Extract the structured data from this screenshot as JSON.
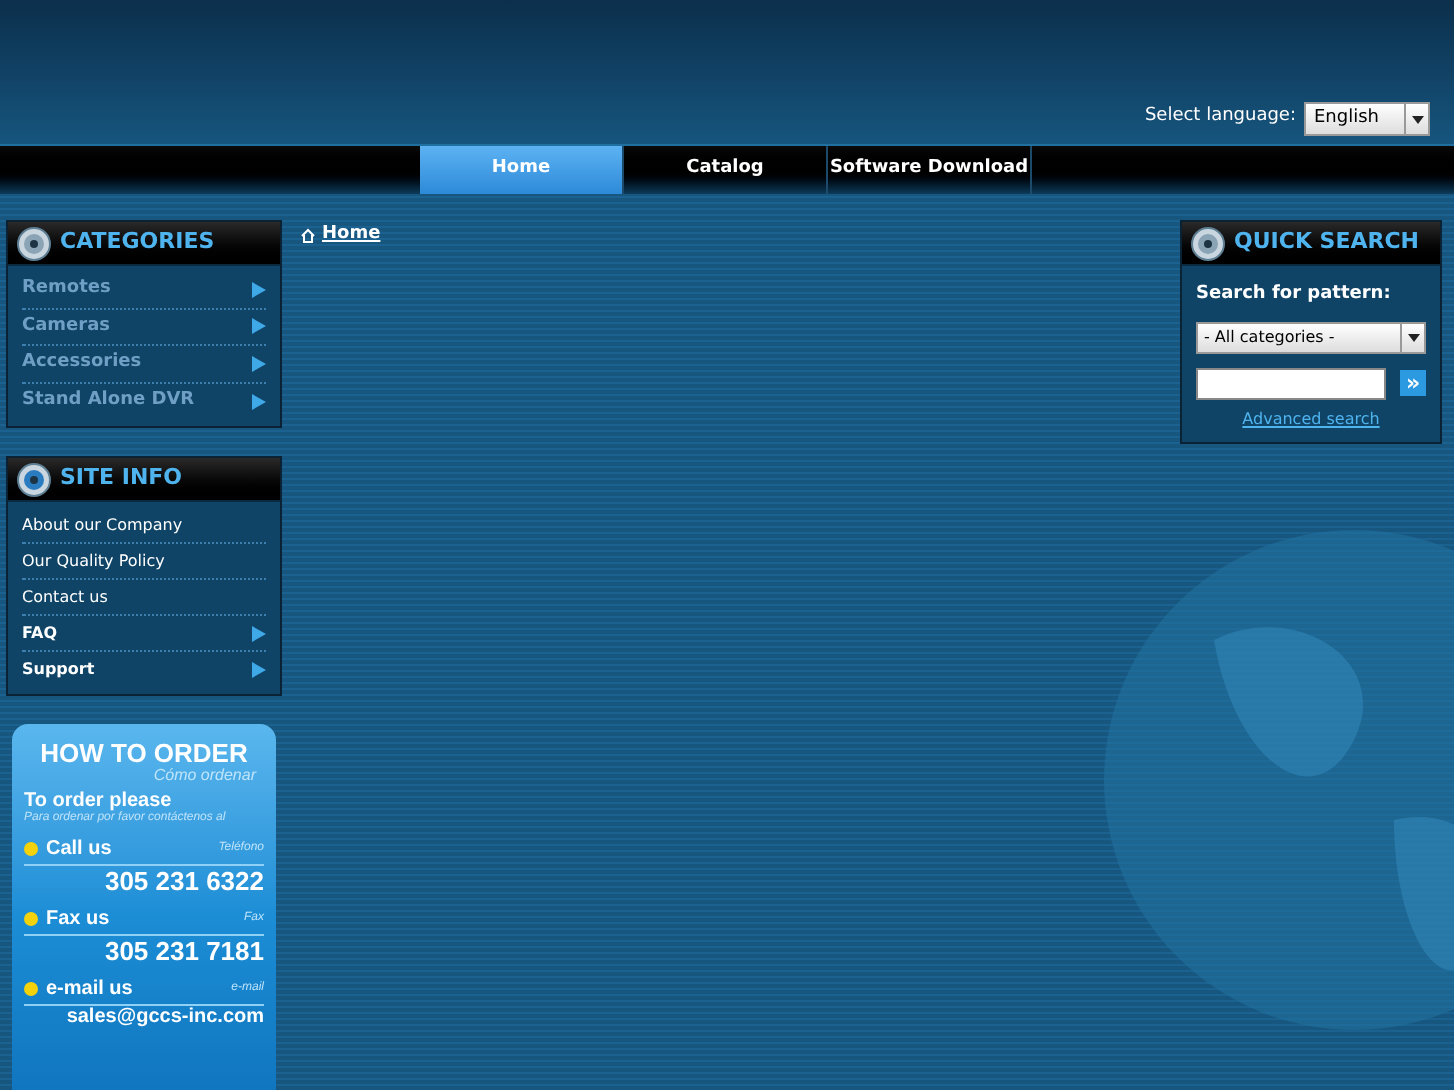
{
  "language": {
    "label": "Select language:",
    "value": "English"
  },
  "nav": [
    {
      "label": "Home",
      "selected": true
    },
    {
      "label": "Catalog",
      "selected": false
    },
    {
      "label": "Software Download",
      "selected": false
    }
  ],
  "breadcrumb": "Home",
  "categories": {
    "title": "CATEGORIES",
    "items": [
      "Remotes",
      "Cameras",
      "Accessories",
      "Stand Alone DVR"
    ]
  },
  "site_info": {
    "title": "SITE INFO",
    "items": [
      {
        "label": "About our Company",
        "kind": "plain"
      },
      {
        "label": "Our Quality Policy",
        "kind": "plain"
      },
      {
        "label": "Contact us",
        "kind": "plain"
      },
      {
        "label": "FAQ",
        "kind": "submenu"
      },
      {
        "label": "Support",
        "kind": "submenu"
      }
    ]
  },
  "how_to_order": {
    "title": "HOW TO ORDER",
    "subtitle": "Cómo ordenar",
    "intro": "To order please",
    "intro_sub": "Para ordenar por favor contáctenos al",
    "contacts": [
      {
        "label": "Call us",
        "sub": "Teléfono",
        "value": "305 231 6322"
      },
      {
        "label": "Fax us",
        "sub": "Fax",
        "value": "305 231 7181"
      },
      {
        "label": "e-mail us",
        "sub": "e-mail",
        "value": "sales@gccs-inc.com"
      }
    ]
  },
  "quick_search": {
    "title": "QUICK SEARCH",
    "label": "Search for pattern:",
    "category": "- All categories -",
    "go": "»",
    "advanced": "Advanced search"
  }
}
